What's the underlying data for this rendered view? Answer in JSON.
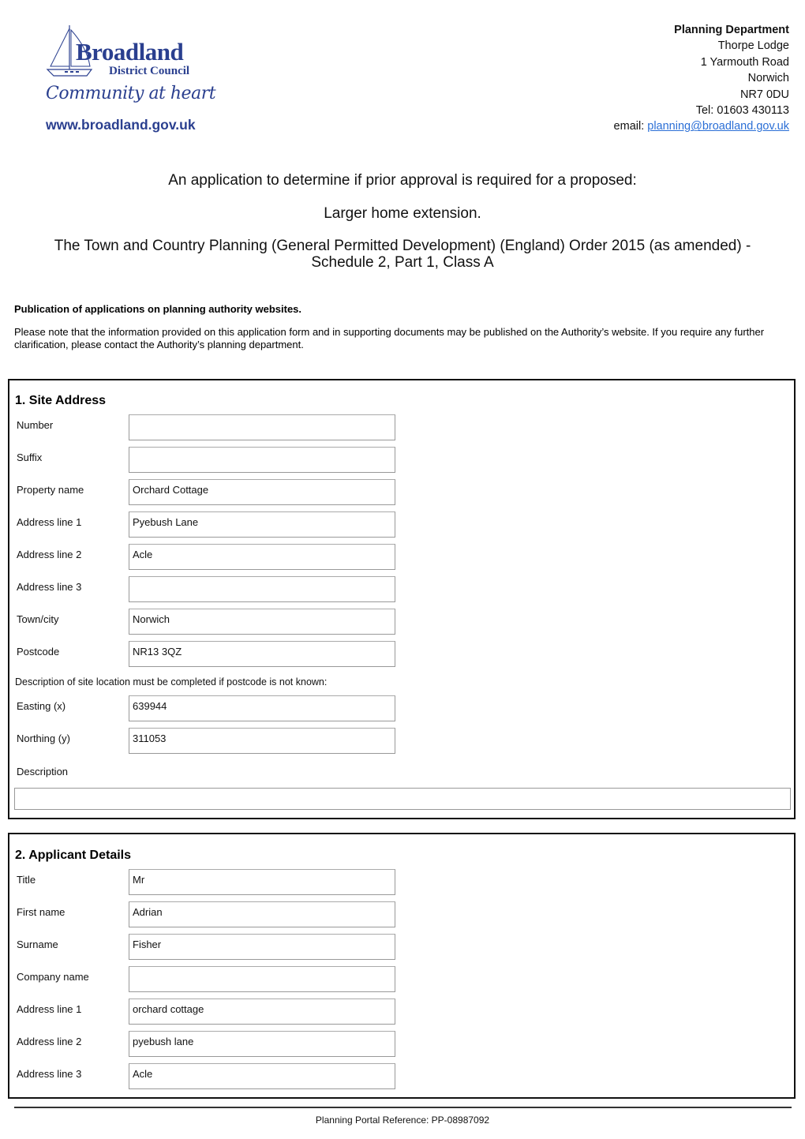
{
  "header": {
    "logo": {
      "name": "Broadland",
      "subname": "District Council",
      "tagline": "Community at heart",
      "website": "www.broadland.gov.uk"
    },
    "address": {
      "department": "Planning Department",
      "line1": "Thorpe Lodge",
      "line2": "1 Yarmouth Road",
      "line3": "Norwich",
      "postcode": "NR7 0DU",
      "tel": "Tel: 01603 430113",
      "email_label": "email:",
      "email": "planning@broadland.gov.uk"
    },
    "brand_color": "#2a3f8f",
    "link_color": "#2b6fd6"
  },
  "title": {
    "line1": "An application to determine if prior approval is required for a proposed:",
    "line2": "Larger home extension.",
    "line3a": "The Town and Country Planning (General Permitted Development) (England) Order 2015 (as amended) -",
    "line3b": "Schedule 2, Part 1, Class A"
  },
  "publication": {
    "heading": "Publication of applications on planning authority websites.",
    "text": "Please note that the information provided on this application form and in supporting documents may be published on the Authority’s website. If you require any further clarification, please contact the Authority’s planning department."
  },
  "site_address": {
    "title": "1. Site Address",
    "fields": [
      {
        "label": "Number",
        "value": ""
      },
      {
        "label": "Suffix",
        "value": ""
      },
      {
        "label": "Property name",
        "value": "Orchard Cottage"
      },
      {
        "label": "Address line 1",
        "value": "Pyebush Lane"
      },
      {
        "label": "Address line 2",
        "value": "Acle"
      },
      {
        "label": "Address line 3",
        "value": ""
      },
      {
        "label": "Town/city",
        "value": "Norwich"
      },
      {
        "label": "Postcode",
        "value": "NR13 3QZ"
      }
    ],
    "location_note": "Description of site location must be completed if postcode is not known:",
    "easting": {
      "label": "Easting (x)",
      "value": "639944"
    },
    "northing": {
      "label": "Northing (y)",
      "value": "311053"
    },
    "description": {
      "label": "Description",
      "value": ""
    }
  },
  "applicant": {
    "title": "2. Applicant Details",
    "fields": [
      {
        "label": "Title",
        "value": "Mr"
      },
      {
        "label": "First name",
        "value": "Adrian"
      },
      {
        "label": "Surname",
        "value": "Fisher"
      },
      {
        "label": "Company name",
        "value": ""
      },
      {
        "label": "Address line 1",
        "value": "orchard cottage"
      },
      {
        "label": "Address line 2",
        "value": "pyebush lane"
      },
      {
        "label": "Address line 3",
        "value": "Acle"
      }
    ]
  },
  "footer": {
    "reference": "Planning Portal Reference: PP-08987092"
  }
}
